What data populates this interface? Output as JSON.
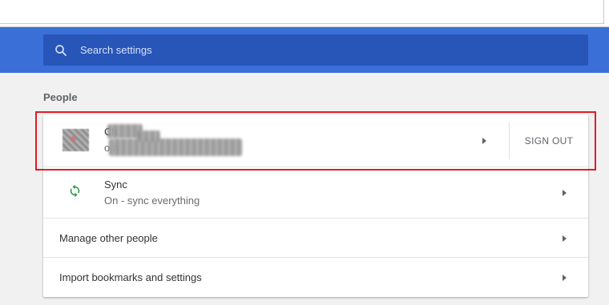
{
  "colors": {
    "header_blue": "#3b6fd8",
    "search_box_blue": "#2855b8",
    "sync_green": "#1e8e3e",
    "highlight_red": "#e01b24"
  },
  "search": {
    "placeholder": "Search settings",
    "icon": "search-icon"
  },
  "section": {
    "title": "People"
  },
  "account": {
    "name": "Ch",
    "email": "o                              n",
    "sign_out_label": "SIGN OUT",
    "avatar_icon": "avatar",
    "chevron_icon": "chevron-right-icon"
  },
  "sync": {
    "title": "Sync",
    "subtitle": "On - sync everything",
    "icon": "sync-icon"
  },
  "manage": {
    "label": "Manage other people"
  },
  "import": {
    "label": "Import bookmarks and settings"
  }
}
